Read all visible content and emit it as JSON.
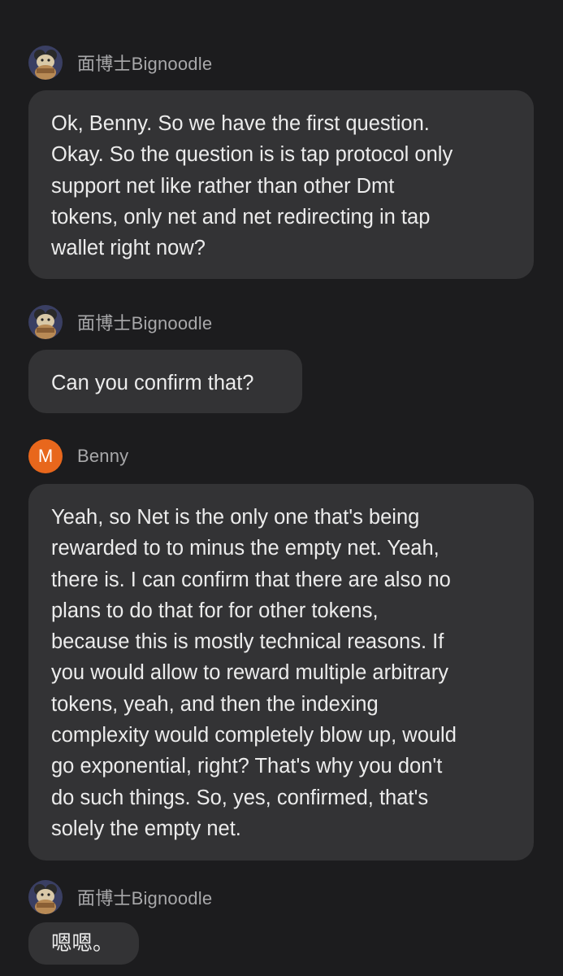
{
  "messages": [
    {
      "sender": "面博士Bignoodle",
      "avatar_icon": "cat-avatar-icon",
      "text": "Ok, Benny. So we have the first question.\nOkay. So the question is is tap protocol only\nsupport net like rather than other Dmt\ntokens, only net and net redirecting in tap\nwallet right now?"
    },
    {
      "sender": "面博士Bignoodle",
      "avatar_icon": "cat-avatar-icon",
      "text": "Can you confirm that?"
    },
    {
      "sender": "Benny",
      "avatar_letter": "M",
      "avatar_color": "#e8671c",
      "text": "Yeah, so Net is the only one that's being\nrewarded to to minus the empty net. Yeah,\nthere is. I can confirm that there are also no\nplans to do that for for other tokens,\nbecause this is mostly technical reasons. If\nyou would allow to reward multiple arbitrary\ntokens, yeah, and then the indexing\ncomplexity would completely blow up, would\ngo exponential, right? That's why you don't\ndo such things. So, yes, confirmed, that's\nsolely the empty net."
    },
    {
      "sender": "面博士Bignoodle",
      "avatar_icon": "cat-avatar-icon",
      "text": "嗯嗯。"
    }
  ]
}
